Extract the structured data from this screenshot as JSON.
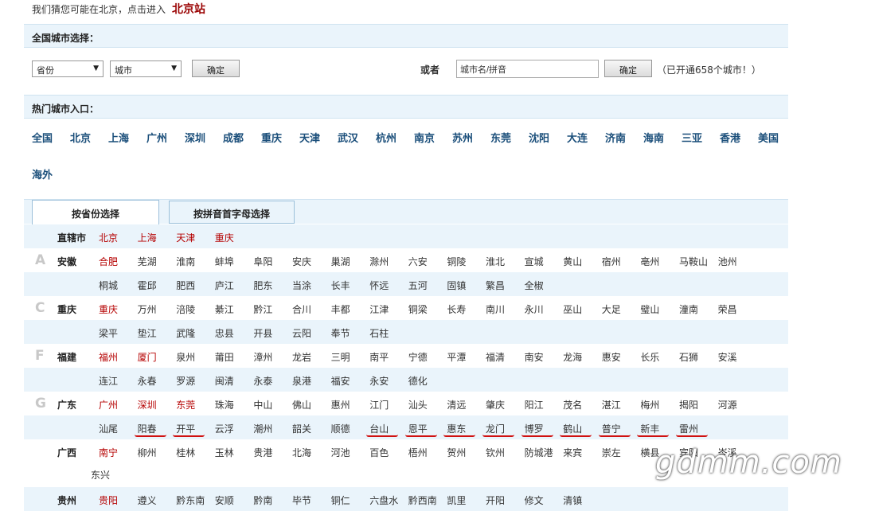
{
  "top": {
    "guess_text": "我们猜您可能在北京，点击进入",
    "site_link": "北京站"
  },
  "national": {
    "title": "全国城市选择：",
    "province_select": "省份",
    "city_select": "城市",
    "confirm": "确定",
    "or": "或者",
    "search_placeholder": "城市名/拼音",
    "confirm2": "确定",
    "note": "（已开通658个城市！）"
  },
  "hot": {
    "title": "热门城市入口：",
    "cities": [
      "全国",
      "北京",
      "上海",
      "广州",
      "深圳",
      "成都",
      "重庆",
      "天津",
      "武汉",
      "杭州",
      "南京",
      "苏州",
      "东莞",
      "沈阳",
      "大连",
      "济南",
      "海南",
      "三亚",
      "香港",
      "美国",
      "海外"
    ]
  },
  "tabs": [
    "按省份选择",
    "按拼音首字母选择"
  ],
  "rows": [
    {
      "letter": "",
      "province": "直辖市",
      "cities": [
        "北京",
        "上海",
        "天津",
        "重庆"
      ],
      "red": 4
    },
    {
      "letter": "A",
      "province": "安徽",
      "cities": [
        "合肥",
        "芜湖",
        "淮南",
        "蚌埠",
        "阜阳",
        "安庆",
        "巢湖",
        "滁州",
        "六安",
        "铜陵",
        "淮北",
        "宣城",
        "黄山",
        "宿州",
        "亳州",
        "马鞍山",
        "池州"
      ],
      "red": 1
    },
    {
      "letter": "",
      "province": "",
      "cities": [
        "桐城",
        "霍邱",
        "肥西",
        "庐江",
        "肥东",
        "当涂",
        "长丰",
        "怀远",
        "五河",
        "固镇",
        "繁昌",
        "全椒"
      ],
      "red": 0
    },
    {
      "letter": "C",
      "province": "重庆",
      "cities": [
        "重庆",
        "万州",
        "涪陵",
        "綦江",
        "黔江",
        "合川",
        "丰都",
        "江津",
        "铜梁",
        "长寿",
        "南川",
        "永川",
        "巫山",
        "大足",
        "璧山",
        "潼南",
        "荣昌"
      ],
      "red": 1
    },
    {
      "letter": "",
      "province": "",
      "cities": [
        "梁平",
        "垫江",
        "武隆",
        "忠县",
        "开县",
        "云阳",
        "奉节",
        "石柱"
      ],
      "red": 0
    },
    {
      "letter": "F",
      "province": "福建",
      "cities": [
        "福州",
        "厦门",
        "泉州",
        "莆田",
        "漳州",
        "龙岩",
        "三明",
        "南平",
        "宁德",
        "平潭",
        "福清",
        "南安",
        "龙海",
        "惠安",
        "长乐",
        "石狮",
        "安溪"
      ],
      "red": 2
    },
    {
      "letter": "",
      "province": "",
      "cities": [
        "连江",
        "永春",
        "罗源",
        "闽清",
        "永泰",
        "泉港",
        "福安",
        "永安",
        "德化"
      ],
      "red": 0
    },
    {
      "letter": "G",
      "province": "广东",
      "cities": [
        "广州",
        "深圳",
        "东莞",
        "珠海",
        "中山",
        "佛山",
        "惠州",
        "江门",
        "汕头",
        "清远",
        "肇庆",
        "阳江",
        "茂名",
        "湛江",
        "梅州",
        "揭阳",
        "河源"
      ],
      "red": 3
    },
    {
      "letter": "",
      "province": "",
      "cities": [
        "汕尾",
        "阳春",
        "开平",
        "云浮",
        "潮州",
        "韶关",
        "顺德",
        "台山",
        "恩平",
        "惠东",
        "龙门",
        "博罗",
        "鹤山",
        "普宁",
        "新丰",
        "雷州"
      ],
      "red": 0
    },
    {
      "letter": "",
      "province": "广西",
      "cities": [
        "南宁",
        "柳州",
        "桂林",
        "玉林",
        "贵港",
        "北海",
        "河池",
        "百色",
        "梧州",
        "贺州",
        "钦州",
        "防城港",
        "来宾",
        "崇左",
        "横县",
        "宾阳",
        "岑溪",
        "东兴"
      ],
      "red": 1
    },
    {
      "letter": "",
      "province": "贵州",
      "cities": [
        "贵阳",
        "遵义",
        "黔东南",
        "安顺",
        "黔南",
        "毕节",
        "铜仁",
        "六盘水",
        "黔西南",
        "凯里",
        "开阳",
        "修文",
        "清镇"
      ],
      "red": 1
    }
  ],
  "watermark": "gdmm.com"
}
